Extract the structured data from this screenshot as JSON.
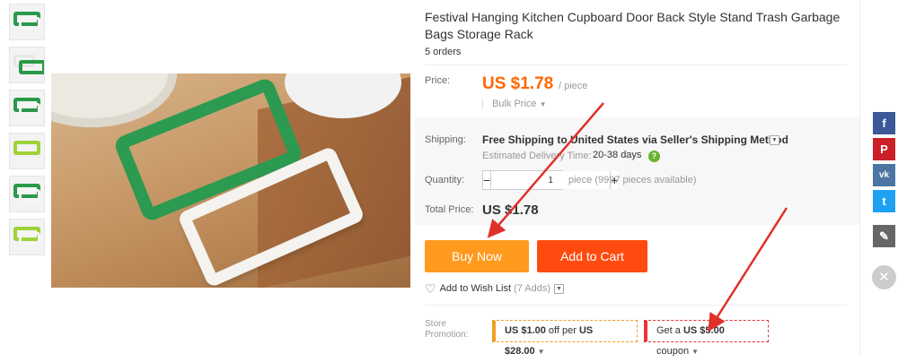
{
  "product": {
    "title": "Festival Hanging Kitchen Cupboard Door Back Style Stand Trash Garbage Bags Storage Rack",
    "orders": "5 orders"
  },
  "price": {
    "label": "Price:",
    "value": "US $1.78",
    "unit": "/ piece",
    "bulk_label": "Bulk Price",
    "color": "#ff6600"
  },
  "shipping": {
    "label": "Shipping:",
    "value": "Free Shipping to United States via Seller's Shipping Method",
    "estimated_label": "Estimated Delivery Time:",
    "estimated_days": "20-38 days"
  },
  "quantity": {
    "label": "Quantity:",
    "value": "1",
    "minus": "−",
    "plus": "+",
    "available": "piece (9997 pieces available)"
  },
  "total": {
    "label": "Total Price:",
    "value": "US $1.78"
  },
  "buttons": {
    "buy_now": "Buy Now",
    "add_to_cart": "Add to Cart",
    "buy_now_color": "#ff9a1f",
    "add_to_cart_color": "#ff4b10"
  },
  "wishlist": {
    "label": "Add to Wish List",
    "count": "(7 Adds)"
  },
  "promotion": {
    "label": "Store Promotion:",
    "offer_amount": "US $1.00",
    "offer_mid": " off per ",
    "offer_threshold": "US $28.00",
    "coupon_pre": "Get a ",
    "coupon_amount": "US $5.00",
    "coupon_post": " coupon"
  },
  "social": {
    "facebook": "f",
    "pinterest": "P",
    "vk": "vk",
    "twitter": "t",
    "edit": "✎",
    "close": "✕"
  },
  "thumbnails": [
    "thumb-1",
    "thumb-2",
    "thumb-3",
    "thumb-4",
    "thumb-5",
    "thumb-6"
  ]
}
